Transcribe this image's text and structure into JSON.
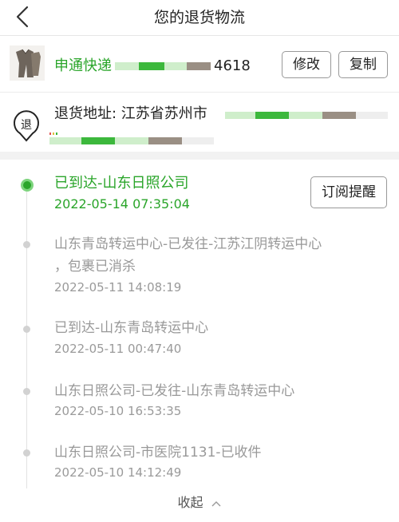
{
  "header": {
    "title": "您的退货物流"
  },
  "package": {
    "tracking_prefix": "申通快递",
    "tracking_suffix": "4618",
    "edit_label": "修改",
    "copy_label": "复制"
  },
  "address": {
    "icon_char": "退",
    "text": "退货地址: 江苏省苏州市"
  },
  "timeline": {
    "subscribe_label": "订阅提醒",
    "events": [
      {
        "title": "已到达-山东日照公司",
        "time": "2022-05-14 07:35:04",
        "active": true
      },
      {
        "title": "山东青岛转运中心-已发往-江苏江阴转运中心",
        "title2": "，包裹已消杀",
        "time": "2022-05-11 14:08:19"
      },
      {
        "title": "已到达-山东青岛转运中心",
        "time": "2022-05-11 00:47:40"
      },
      {
        "title": "山东日照公司-已发往-山东青岛转运中心",
        "time": "2022-05-10 16:53:35"
      },
      {
        "title": "山东日照公司-市医院1131-已收件",
        "time": "2022-05-10 14:12:49"
      }
    ]
  },
  "footer": {
    "collapse_label": "收起"
  },
  "colors": {
    "accent": "#2aa52a",
    "muted": "#999999"
  }
}
